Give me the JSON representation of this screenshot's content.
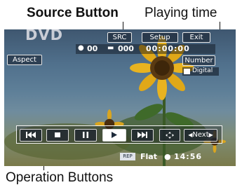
{
  "callouts": {
    "source_button": "Source Button",
    "playing_time": "Playing time",
    "operation_buttons": "Operation Buttons"
  },
  "screen": {
    "source_label": "DVD",
    "top_buttons": {
      "src": "SRC",
      "setup": "Setup",
      "exit": "Exit"
    },
    "playing_info": {
      "title_number": "00",
      "chapter_number": "000",
      "time": "00:00:00"
    },
    "aspect_button": "Aspect",
    "number_button": "Number",
    "digital_badge": "Digital",
    "controls": {
      "prev_icon": "skip-previous-icon",
      "stop_icon": "stop-icon",
      "pause_icon": "pause-icon",
      "play_icon": "play-icon",
      "next_icon": "skip-next-icon",
      "cursor_icon": "cursor-icon",
      "next_page_label": "Next"
    },
    "status": {
      "repeat": "REP",
      "sound_mode": "Flat",
      "clock": "14:56"
    }
  }
}
